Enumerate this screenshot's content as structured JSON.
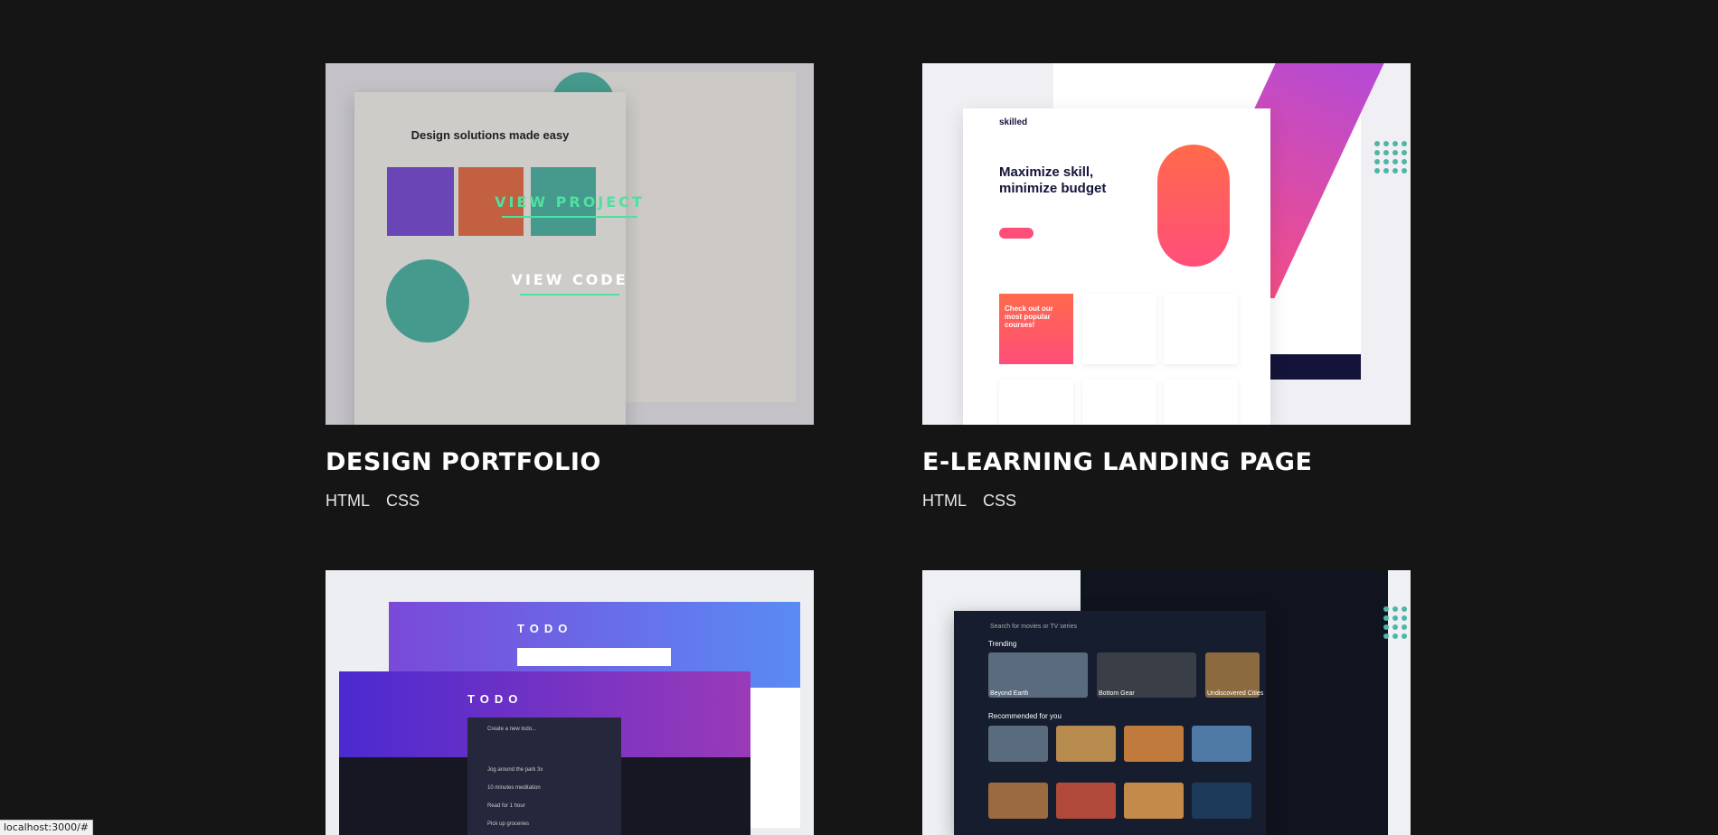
{
  "projects": [
    {
      "title": "DESIGN PORTFOLIO",
      "tags": [
        "HTML",
        "CSS"
      ],
      "hover": {
        "view_project": "VIEW PROJECT",
        "view_code": "VIEW CODE"
      },
      "preview": {
        "heading": "Design solutions made easy"
      }
    },
    {
      "title": "E-LEARNING LANDING PAGE",
      "tags": [
        "HTML",
        "CSS"
      ],
      "preview": {
        "logo": "skilled",
        "heading": "Maximize skill, minimize budget",
        "card": "Check out our most popular courses!"
      }
    },
    {
      "title": "",
      "tags": [],
      "preview": {
        "heading": "TODO",
        "placeholder": "Create a new todo...",
        "items": [
          "Jog around the park 3x",
          "10 minutes meditation",
          "Read for 1 hour",
          "Pick up groceries"
        ]
      }
    },
    {
      "title": "",
      "tags": [],
      "preview": {
        "search": "Search for movies or TV series",
        "trending": "Trending",
        "recommended": "Recommended for you",
        "items": [
          "Beyond Earth",
          "Bottom Gear",
          "Undiscovered Cities"
        ]
      }
    }
  ],
  "status_url": "localhost:3000/#",
  "colors": {
    "accent": "#4ee1a0",
    "background": "#151515"
  }
}
